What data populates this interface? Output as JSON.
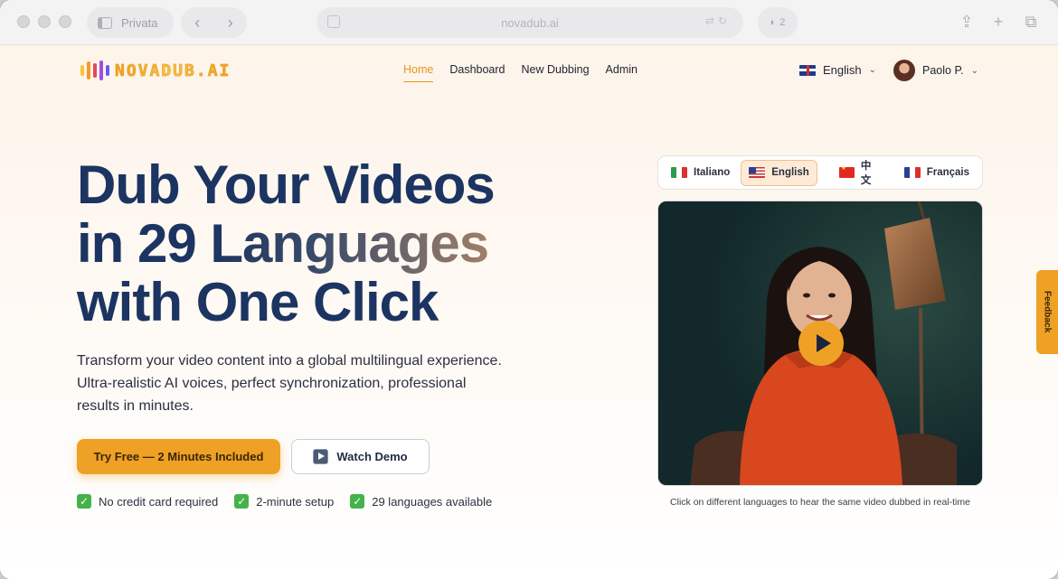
{
  "browser": {
    "tab_label": "Privata",
    "url": "novadub.ai",
    "shield_count": "2"
  },
  "site": {
    "logo_text": "NOVADUB.AI",
    "logo_colors": [
      "#f6c63a",
      "#f39a2a",
      "#e5485a",
      "#a64be0",
      "#6a5bea"
    ],
    "accent": "#eea125",
    "heading_color": "#1c3461"
  },
  "nav": {
    "items": [
      {
        "label": "Home",
        "active": true
      },
      {
        "label": "Dashboard"
      },
      {
        "label": "New Dubbing"
      },
      {
        "label": "Admin"
      }
    ],
    "language": "English",
    "user_name": "Paolo P."
  },
  "hero": {
    "line1": "Dub Your Videos",
    "line2_a": "in 29 ",
    "line2_b": "Languages",
    "line3": "with One Click",
    "subtitle": "Transform your video content into a global multilingual experience. Ultra-realistic AI voices, perfect synchronization, professional results in minutes.",
    "cta_primary": "Try Free — 2 Minutes Included",
    "cta_secondary": "Watch Demo",
    "checks": [
      "No credit card required",
      "2-minute setup",
      "29 languages available"
    ]
  },
  "demo": {
    "languages": [
      {
        "label": "Italiano",
        "flag": "it"
      },
      {
        "label": "English",
        "flag": "us",
        "active": true
      },
      {
        "label": "中文",
        "flag": "cn"
      },
      {
        "label": "Français",
        "flag": "fr"
      }
    ],
    "caption": "Click on different languages to hear the same video dubbed in real-time"
  },
  "feedback": {
    "label": "Feedback"
  }
}
